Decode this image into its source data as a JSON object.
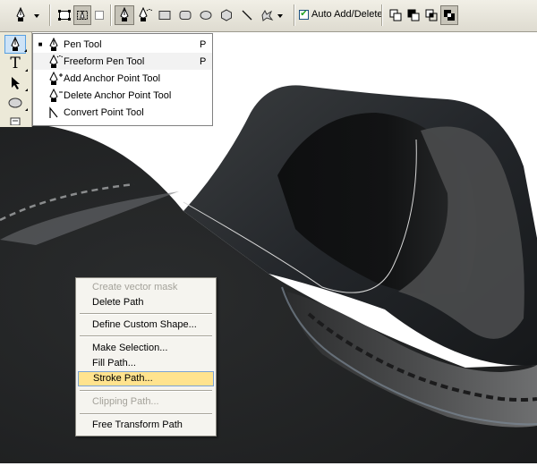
{
  "options_bar": {
    "pen_tool_icon": "pen-icon",
    "auto_add_delete_label": "Auto Add/Delete",
    "auto_add_delete_checked": true,
    "shape_layers_icon": "shape-layers-icon",
    "paths_icon": "paths-icon",
    "fill_pixels_icon": "fill-pixels-icon",
    "rect_icon": "rectangle-icon",
    "rounded_rect_icon": "rounded-rectangle-icon",
    "ellipse_icon": "ellipse-icon",
    "polygon_icon": "polygon-icon",
    "line_icon": "line-icon",
    "custom_shape_icon": "custom-shape-icon"
  },
  "pen_flyout": {
    "items": [
      {
        "label": "Pen Tool",
        "shortcut": "P",
        "selected": true,
        "icon": "pen-icon"
      },
      {
        "label": "Freeform Pen Tool",
        "shortcut": "P",
        "selected": false,
        "icon": "freeform-pen-icon"
      },
      {
        "label": "Add Anchor Point Tool",
        "shortcut": "",
        "selected": false,
        "icon": "add-anchor-icon"
      },
      {
        "label": "Delete Anchor Point Tool",
        "shortcut": "",
        "selected": false,
        "icon": "delete-anchor-icon"
      },
      {
        "label": "Convert Point Tool",
        "shortcut": "",
        "selected": false,
        "icon": "convert-point-icon"
      }
    ]
  },
  "tools_panel": {
    "text_tool_glyph": "T"
  },
  "context_menu": {
    "items": [
      {
        "label": "Create vector mask",
        "enabled": false
      },
      {
        "label": "Delete Path",
        "enabled": true
      },
      {
        "label": "Define Custom Shape...",
        "enabled": true
      },
      {
        "label": "Make Selection...",
        "enabled": true
      },
      {
        "label": "Fill Path...",
        "enabled": true
      },
      {
        "label": "Stroke Path...",
        "enabled": true,
        "highlighted": true
      },
      {
        "label": "Clipping Path...",
        "enabled": false
      },
      {
        "label": "Free Transform Path",
        "enabled": true
      }
    ]
  },
  "colors": {
    "highlight": "#ffe38e",
    "highlight_border": "#7aa2d4",
    "disabled_text": "#a4a29a",
    "leather_dark": "#1b1d1e",
    "stitch": "#8a8c8d"
  }
}
